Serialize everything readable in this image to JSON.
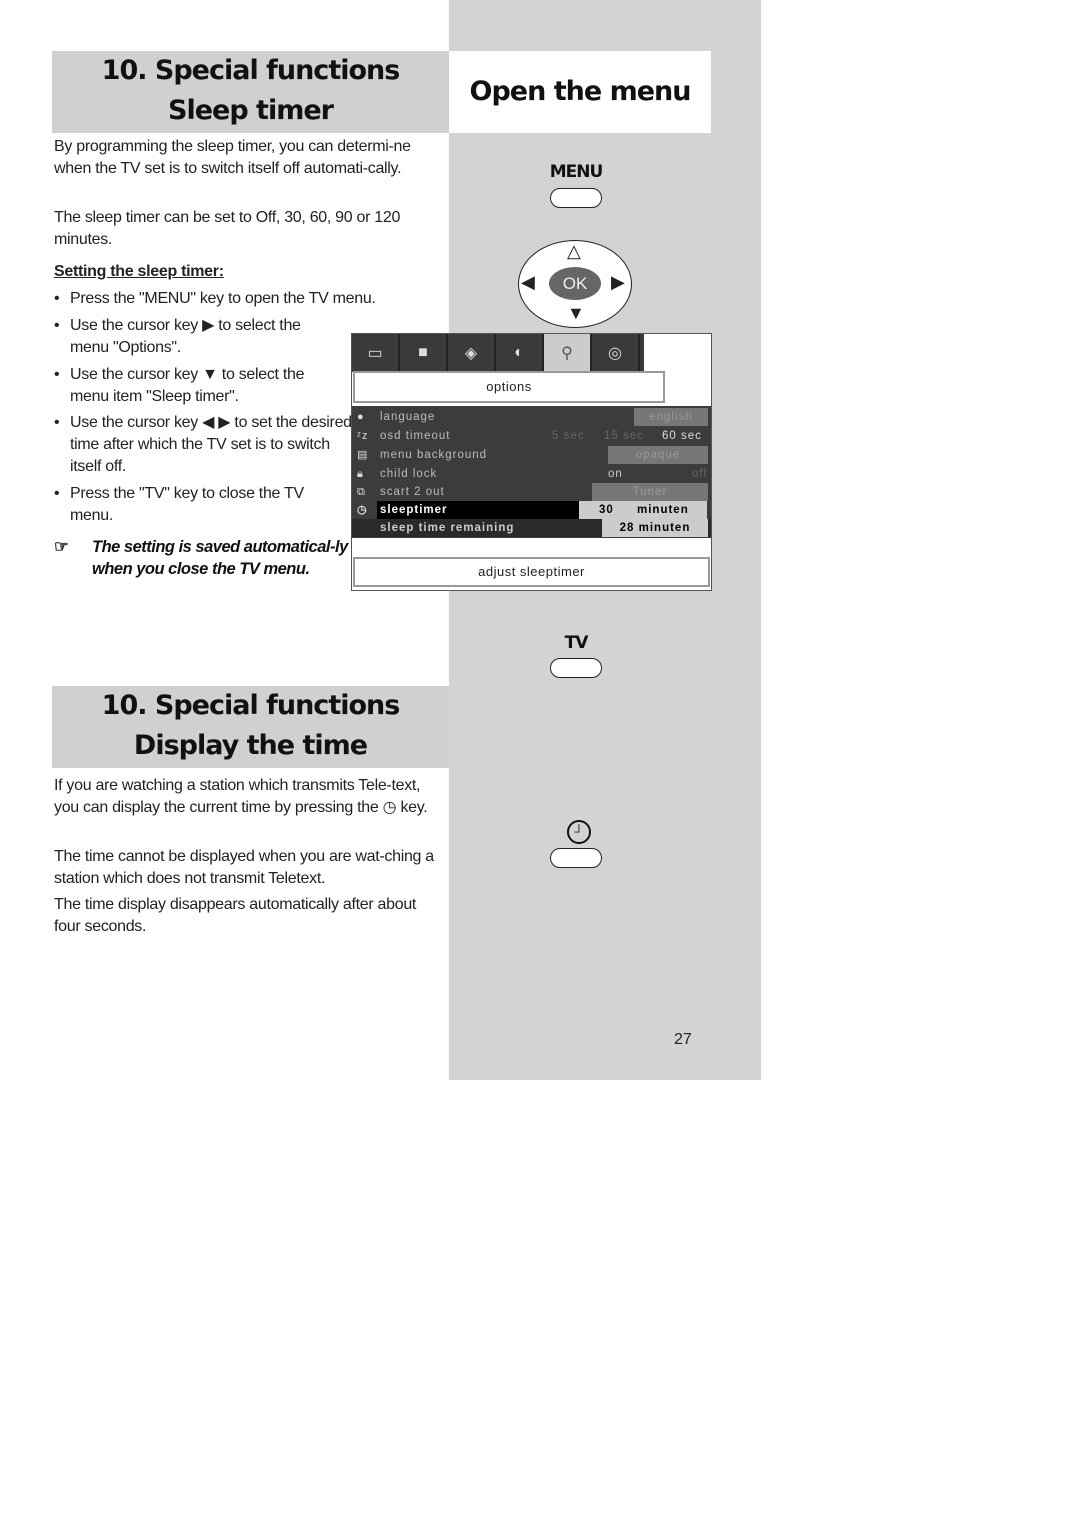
{
  "sleep_section": {
    "title_line1": "10. Special functions",
    "title_line2": "Sleep timer",
    "intro": "By programming the sleep timer, you can determi-ne when the TV set is to switch itself off automati-cally.",
    "options_text": "The sleep timer can be set to Off, 30, 60, 90 or 120 minutes.",
    "subheading": "Setting the sleep timer:",
    "steps": [
      "Press the \"MENU\" key to open the TV menu.",
      "Use the cursor key ▶ to select the menu \"Options\".",
      "Use the cursor key ▼ to select the menu item \"Sleep timer\".",
      "Use the cursor key ◀ ▶ to set the desired time after which the TV set is to switch itself off.",
      "Press the \"TV\" key to close the TV menu."
    ],
    "note_icon": "pointing-hand-icon",
    "note": "The setting is saved automatical-ly when you close the TV menu."
  },
  "right_column": {
    "title": "Open the menu",
    "menu_key": "MENU",
    "ok_key": "OK",
    "tv_key": "TV",
    "clock_key_icon": "clock-icon"
  },
  "tv_menu": {
    "tabs": [
      "picture-in-picture-icon",
      "picture-icon",
      "format-icon",
      "sound-icon",
      "options-icon",
      "channels-icon"
    ],
    "selected_tab": 4,
    "title": "options",
    "rows": [
      {
        "label": "language",
        "value": "english"
      },
      {
        "label": "osd timeout",
        "value_options": [
          "5 sec",
          "15 sec",
          "60 sec"
        ]
      },
      {
        "label": "menu background",
        "value": "opaque"
      },
      {
        "label": "child lock",
        "value_options": [
          "on",
          "off"
        ]
      },
      {
        "label": "scart 2 out",
        "value": "Tuner"
      },
      {
        "label": "sleeptimer",
        "value_num": "30",
        "value_unit": "minuten"
      },
      {
        "label": "sleep time remaining",
        "value": "28 minuten"
      }
    ],
    "footer": "adjust sleeptimer"
  },
  "time_section": {
    "title_line1": "10. Special functions",
    "title_line2": "Display the time",
    "p1_a": "If you are watching a station which transmits Tele-text, you can display the current time by pressing the",
    "p1_b": "key.",
    "p2": "The time cannot be displayed when you are wat-ching a station which does not transmit Teletext.",
    "p3": "The time display disappears automatically after about four seconds."
  },
  "page_number": "27"
}
